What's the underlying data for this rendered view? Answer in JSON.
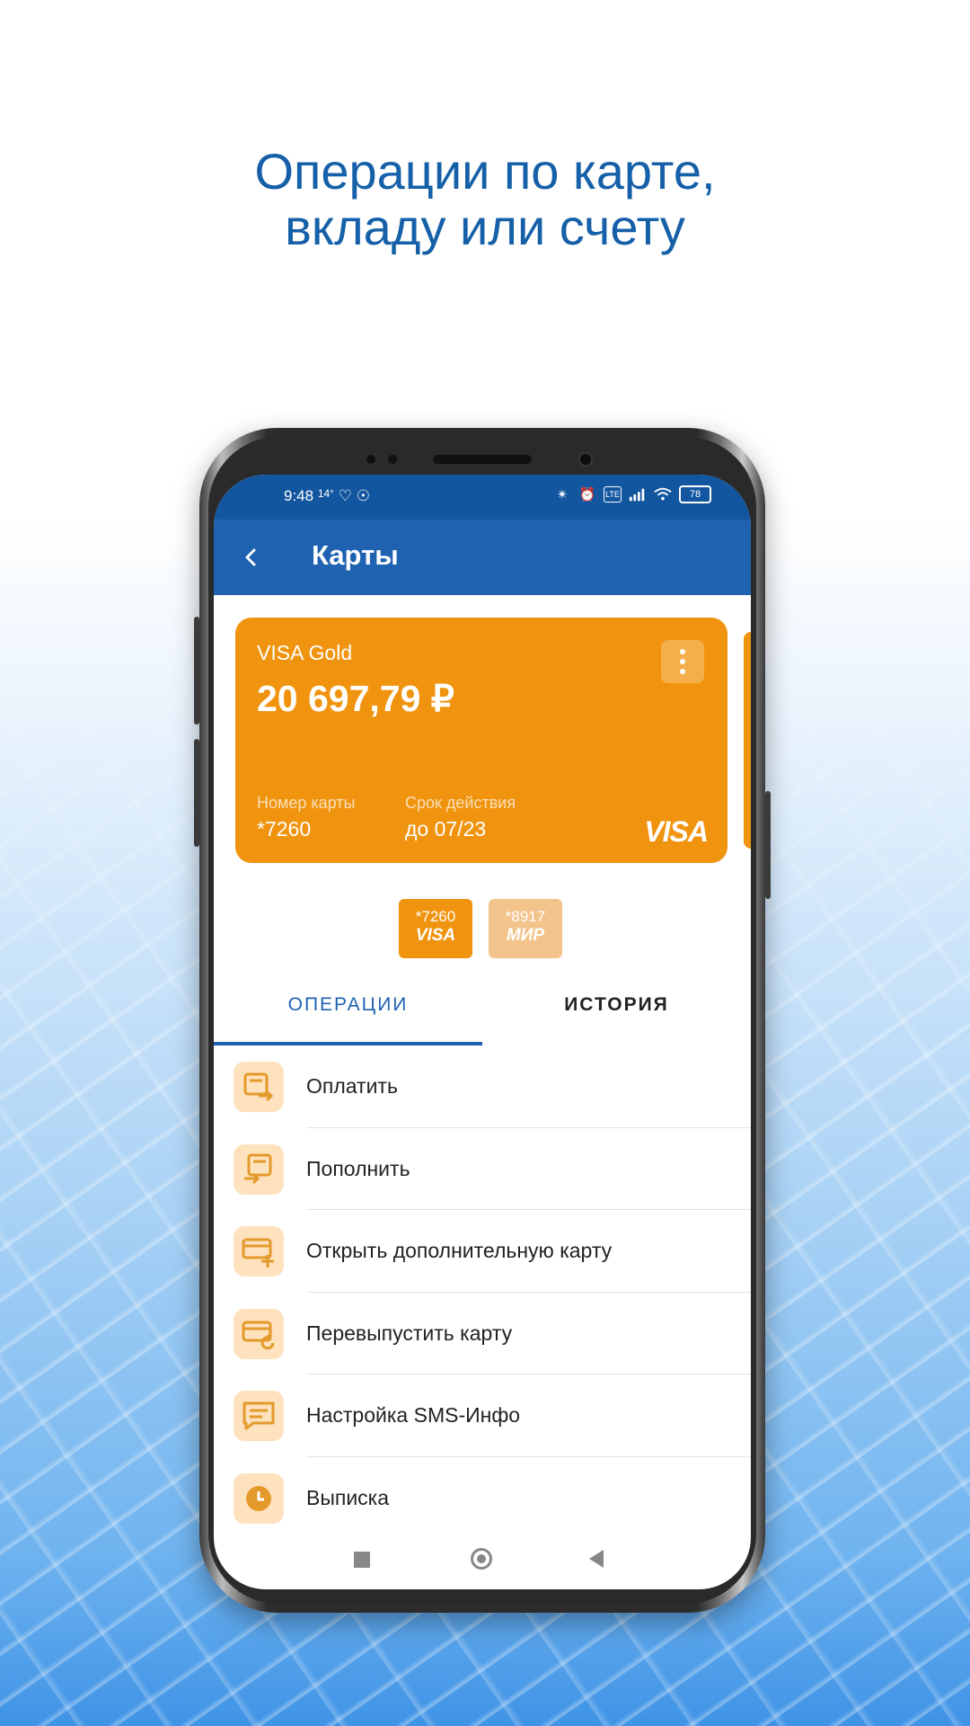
{
  "headline": {
    "line1": "Операции по карте,",
    "line2": "вкладу или счету"
  },
  "statusbar": {
    "time": "9:48",
    "temp": "14°",
    "battery": "78"
  },
  "appbar": {
    "title": "Карты"
  },
  "card": {
    "name": "VISA Gold",
    "balance": "20 697,79 ₽",
    "number_label": "Номер карты",
    "number_value": "*7260",
    "expiry_label": "Срок действия",
    "expiry_value": "до 07/23",
    "brand": "VISA"
  },
  "mini_cards": [
    {
      "num": "*7260",
      "brand": "VISA"
    },
    {
      "num": "*8917",
      "brand": "МИР"
    }
  ],
  "tabs": [
    {
      "label": "ОПЕРАЦИИ"
    },
    {
      "label": "ИСТОРИЯ"
    }
  ],
  "operations": [
    {
      "label": "Оплатить"
    },
    {
      "label": "Пополнить"
    },
    {
      "label": "Открыть дополнительную карту"
    },
    {
      "label": "Перевыпустить карту"
    },
    {
      "label": "Настройка SMS-Инфо"
    },
    {
      "label": "Выписка"
    }
  ],
  "colors": {
    "primary": "#1e62b1",
    "card": "#f0940f",
    "icon_bg": "#fde2bd"
  }
}
